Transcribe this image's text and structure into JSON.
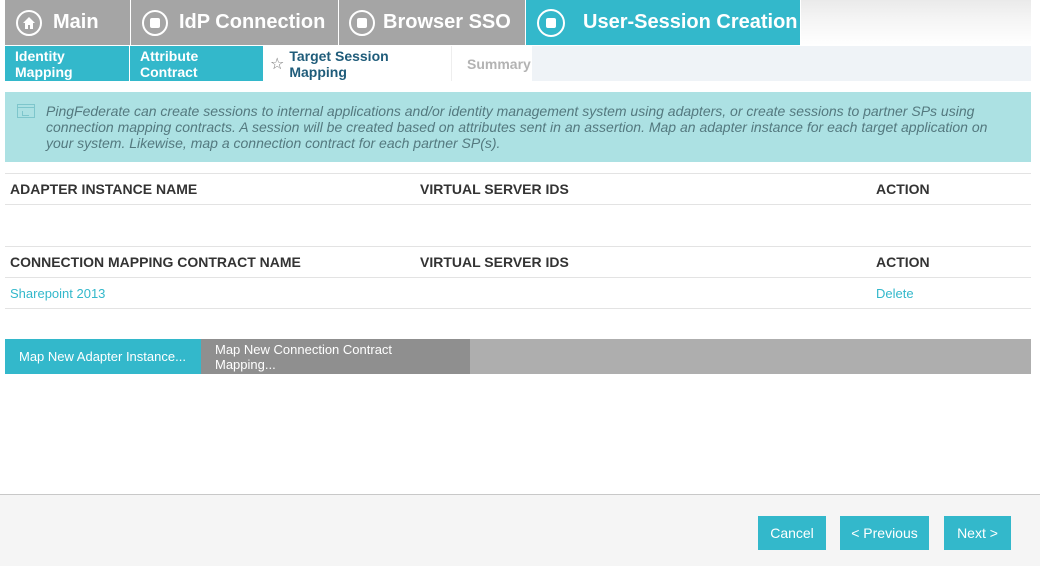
{
  "top_tabs": [
    {
      "label": "Main",
      "icon": "home-icon",
      "state": "inactive"
    },
    {
      "label": "IdP Connection",
      "icon": "stop-icon",
      "state": "inactive"
    },
    {
      "label": "Browser SSO",
      "icon": "stop-icon",
      "state": "inactive"
    },
    {
      "label": "User-Session Creation",
      "icon": "stop-icon",
      "state": "active"
    }
  ],
  "sub_tabs": [
    {
      "label": "Identity Mapping",
      "state": "done"
    },
    {
      "label": "Attribute Contract",
      "state": "done"
    },
    {
      "label": "Target Session Mapping",
      "state": "current"
    },
    {
      "label": "Summary",
      "state": "future"
    }
  ],
  "info": {
    "text": "PingFederate can create sessions to internal applications and/or identity management system using adapters, or create sessions to partner SPs using connection mapping contracts. A session will be created based on attributes sent in an assertion. Map an adapter instance for each target application on your system. Likewise, map a connection contract for each partner SP(s)."
  },
  "adapter_table": {
    "headers": [
      "ADAPTER INSTANCE NAME",
      "VIRTUAL SERVER IDS",
      "ACTION"
    ],
    "rows": []
  },
  "contract_table": {
    "headers": [
      "CONNECTION MAPPING CONTRACT NAME",
      "VIRTUAL SERVER IDS",
      "ACTION"
    ],
    "rows": [
      {
        "name": "Sharepoint 2013",
        "virtual_server_ids": "",
        "action": "Delete"
      }
    ]
  },
  "actions": {
    "map_adapter": "Map New Adapter Instance...",
    "map_contract": "Map New Connection Contract Mapping..."
  },
  "footer": {
    "cancel": "Cancel",
    "previous": "< Previous",
    "next": "Next >"
  },
  "colors": {
    "accent": "#33b8cb",
    "inactive_tab": "#a5a5a5",
    "info_bg": "#ace1e3"
  }
}
